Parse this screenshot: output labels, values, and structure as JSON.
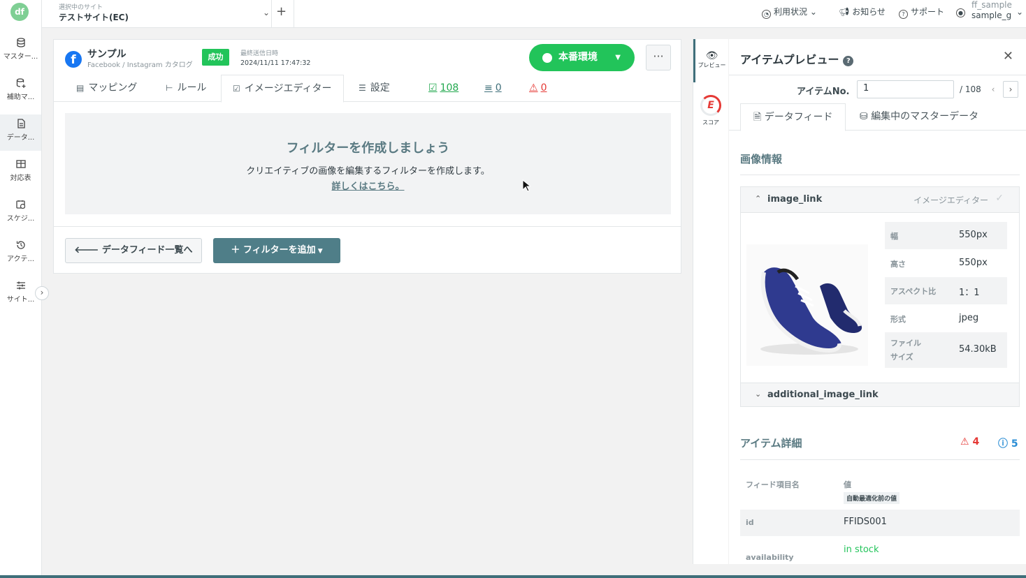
{
  "app": {
    "logo_text": "df"
  },
  "rail": {
    "items": [
      {
        "label": "マスター...",
        "icon": "database-icon"
      },
      {
        "label": "補助マ...",
        "icon": "database-add-icon"
      },
      {
        "label": "データ...",
        "icon": "document-icon"
      },
      {
        "label": "対応表",
        "icon": "table-icon"
      },
      {
        "label": "スケジ...",
        "icon": "calendar-clock-icon"
      },
      {
        "label": "アクテ...",
        "icon": "history-icon"
      },
      {
        "label": "サイト...",
        "icon": "sliders-icon"
      }
    ],
    "expand_glyph": "›"
  },
  "topbar": {
    "site_label": "選択中のサイト",
    "site_value": "テストサイト(EC)",
    "nav_usage": "利用状況",
    "nav_notice": "お知らせ",
    "nav_support": "サポート",
    "user_line1": "ff_sample",
    "user_line2": "sample_g"
  },
  "feed": {
    "name": "サンプル",
    "subtitle": "Facebook / Instagram カタログ",
    "status": "成功",
    "sent_label": "最終送信日時",
    "sent_value": "2024/11/11 17:47:32",
    "env_button": "本番環境",
    "more": "···"
  },
  "tabs": {
    "mapping": "マッピング",
    "rule": "ルール",
    "image_editor": "イメージエディター",
    "settings": "設定",
    "count_ok": "108",
    "count_excluded": "0",
    "count_warning": "0"
  },
  "empty": {
    "title": "フィルターを作成しましょう",
    "desc": "クリエイティブの画像を編集するフィルターを作成します。",
    "link": "詳しくはこちら。"
  },
  "actions": {
    "back": "データフィード一覧へ",
    "add_filter": "フィルターを追加"
  },
  "side": {
    "preview": "プレビュー",
    "score": "スコア",
    "score_letter": "E"
  },
  "panel": {
    "title": "アイテムプレビュー",
    "item_no_label": "アイテムNo.",
    "item_no_value": "1",
    "item_total": "/ 108",
    "tab_feed": "データフィード",
    "tab_master": "編集中のマスターデータ",
    "image_section": "画像情報",
    "image_field": "image_link",
    "image_source": "イメージエディター",
    "specs": [
      {
        "k": "幅",
        "v": "550px"
      },
      {
        "k": "高さ",
        "v": "550px"
      },
      {
        "k": "アスペクト比",
        "v": "1：1"
      },
      {
        "k": "形式",
        "v": "jpeg"
      },
      {
        "k": "ファイル\nサイズ",
        "v": "54.30kB"
      }
    ],
    "additional_field": "additional_image_link",
    "detail_section": "アイテム詳細",
    "warning_count": "4",
    "info_count": "5",
    "col_name": "フィード項目名",
    "col_value": "値",
    "col_value_sub": "自動最適化前の値",
    "rows": [
      {
        "k": "id",
        "v": "FFIDS001"
      },
      {
        "k": "availability",
        "v": "in stock"
      }
    ]
  },
  "colors": {
    "accent_green": "#22c45a",
    "teal": "#4f7e88",
    "warning": "#e53935",
    "info": "#2a8dd4"
  }
}
